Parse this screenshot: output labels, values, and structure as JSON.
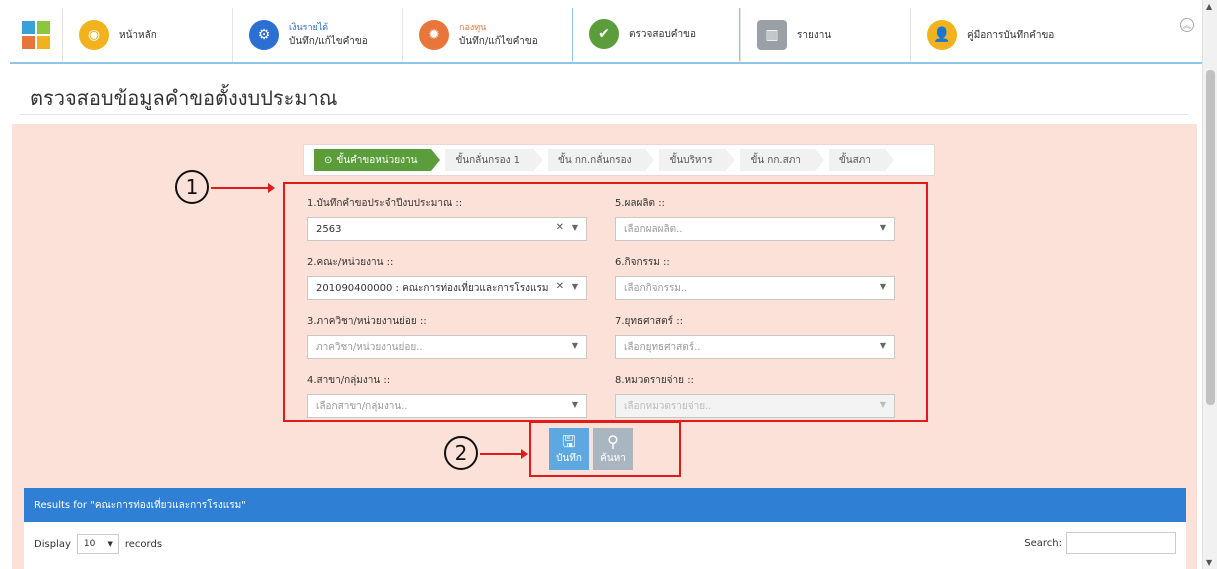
{
  "nav": {
    "tabs": [
      {
        "label": "หน้าหลัก",
        "sup": "",
        "icon": "dashboard-icon",
        "color": "#f2b21d"
      },
      {
        "label": "บันทึก/แก้ไขคำขอ",
        "sup": "เงินรายได้",
        "icon": "gears-icon",
        "color": "#2a6fd1"
      },
      {
        "label": "บันทึก/แก้ไขคำขอ",
        "sup": "กองทุน",
        "icon": "gear-icon",
        "color": "#e8763a"
      },
      {
        "label": "ตรวจสอบคำขอ",
        "sup": "",
        "icon": "check-circle-icon",
        "color": "#5a9d3a"
      },
      {
        "label": "รายงาน",
        "sup": "",
        "icon": "bar-chart-icon",
        "color": "#9aa0a6"
      },
      {
        "label": "คู่มือการบันทึกคำขอ",
        "sup": "",
        "icon": "user-guide-icon",
        "color": "#f2b21d"
      }
    ]
  },
  "page": {
    "title": "ตรวจสอบข้อมูลคำขอตั้งงบประมาณ"
  },
  "steps": [
    "ขั้นคำขอหน่วยงาน",
    "ขั้นกลั่นกรอง 1",
    "ขั้น กก.กลั่นกรอง",
    "ขั้นบริหาร",
    "ขั้น กก.สภา",
    "ขั้นสภา"
  ],
  "form": {
    "f1": {
      "label": "1.บันทึกคำขอประจำปีงบประมาณ ::",
      "value": "2563"
    },
    "f2": {
      "label": "2.คณะ/หน่วยงาน ::",
      "value": "201090400000 : คณะการท่องเที่ยวและการโรงแรม"
    },
    "f3": {
      "label": "3.ภาควิชา/หน่วยงานย่อย ::",
      "placeholder": "ภาควิชา/หน่วยงานย่อย.."
    },
    "f4": {
      "label": "4.สาขา/กลุ่มงาน ::",
      "placeholder": "เลือกสาขา/กลุ่มงาน.."
    },
    "f5": {
      "label": "5.ผลผลิต ::",
      "placeholder": "เลือกผลผลิต.."
    },
    "f6": {
      "label": "6.กิจกรรม ::",
      "placeholder": "เลือกกิจกรรม.."
    },
    "f7": {
      "label": "7.ยุทธศาสตร์ ::",
      "placeholder": "เลือกยุทธศาสตร์.."
    },
    "f8": {
      "label": "8.หมวดรายจ่าย ::",
      "placeholder": "เลือกหมวดรายจ่าย.."
    }
  },
  "buttons": {
    "save": "บันทึก",
    "search": "ค้นหา"
  },
  "callouts": {
    "one": "1",
    "two": "2"
  },
  "results": {
    "title": "Results for \"คณะการท่องเที่ยวและการโรงแรม\"",
    "display_label": "Display",
    "display_value": "10",
    "records_label": "records",
    "search_label": "Search:"
  },
  "colors": {
    "accent_blue": "#2f7fd4",
    "panel": "#fbe1d7",
    "highlight_red": "#e01b1b",
    "step_active": "#5a9d3a"
  }
}
